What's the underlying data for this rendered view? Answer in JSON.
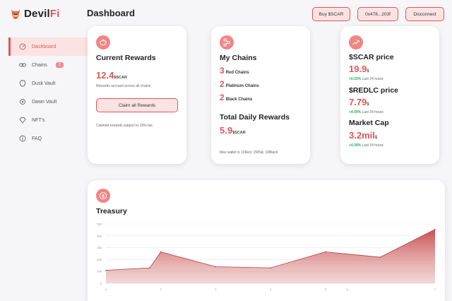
{
  "app": {
    "brand_main": "Devil",
    "brand_accent": "Fi",
    "page_title": "Dashboard"
  },
  "colors": {
    "accent": "#e25656",
    "accent_light": "#fbe3e3",
    "positive": "#27ae60"
  },
  "header": {
    "buy_label": "Buy $SCAR",
    "wallet_label": "0x478...203f",
    "disconnect_label": "Disconnect"
  },
  "sidebar": {
    "items": [
      {
        "label": "Dashboard",
        "icon": "dashboard-icon",
        "active": true
      },
      {
        "label": "Chains",
        "icon": "chain-icon",
        "badge": "2"
      },
      {
        "label": "Dusk Vault",
        "icon": "vault-icon"
      },
      {
        "label": "Dawn Vault",
        "icon": "vault-gear-icon"
      },
      {
        "label": "NFT's",
        "icon": "diamond-icon"
      },
      {
        "label": "FAQ",
        "icon": "info-icon"
      }
    ]
  },
  "rewards": {
    "title": "Current Rewards",
    "value": "12.4",
    "unit": "$SCAR",
    "subtitle": "Rewards accrued across all chains",
    "claim_label": "Claim all Rewards",
    "note": "Claimed rewards subject to 15% tax."
  },
  "chains": {
    "title": "My Chains",
    "rows": [
      {
        "count": "3",
        "label": "Red Chains"
      },
      {
        "count": "2",
        "label": "Platinum Chains"
      },
      {
        "count": "2",
        "label": "Black Chains"
      }
    ],
    "daily_title": "Total Daily Rewards",
    "daily_value": "5.9",
    "daily_unit": "$SCAR",
    "note": "Max wallet is 10Red, 15Plat, 10Black"
  },
  "prices": {
    "scar": {
      "title": "$SCAR price",
      "value": "19.9",
      "suffix": "$",
      "change": "+0.02%",
      "period": "Last 24 hours"
    },
    "redlc": {
      "title": "$REDLC price",
      "value": "7.79",
      "suffix": "$",
      "change": "+4.09%",
      "period": "Last 24 hours"
    },
    "mcap": {
      "title": "Market Cap",
      "value": "3.2mil",
      "suffix": "$",
      "change": "+4.09%",
      "period": "Last 24 hours"
    }
  },
  "treasury": {
    "title": "Treasury"
  },
  "chart_data": {
    "type": "area",
    "yticks": [
      "0",
      "100",
      "200",
      "300",
      "400",
      "500"
    ],
    "ylim": [
      0,
      500
    ],
    "xticks": [
      "1",
      "2",
      "3",
      "4",
      "5",
      "6",
      "7"
    ],
    "x": [
      1,
      1.8,
      2,
      3,
      4,
      5,
      6,
      7
    ],
    "values": [
      110,
      130,
      265,
      140,
      130,
      265,
      220,
      455
    ],
    "grid": true
  }
}
